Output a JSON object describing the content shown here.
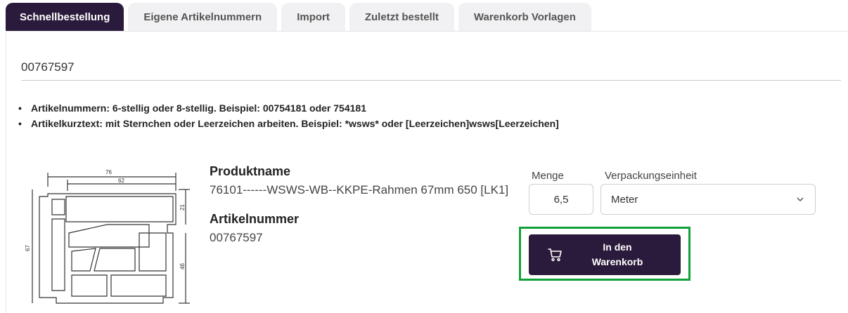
{
  "tabs": [
    {
      "label": "Schnellbestellung",
      "active": true
    },
    {
      "label": "Eigene Artikelnummern",
      "active": false
    },
    {
      "label": "Import",
      "active": false
    },
    {
      "label": "Zuletzt bestellt",
      "active": false
    },
    {
      "label": "Warenkorb Vorlagen",
      "active": false
    }
  ],
  "search": {
    "value": "00767597"
  },
  "hints": [
    "Artikelnummern: 6-stellig oder 8-stellig. Beispiel: 00754181 oder 754181",
    "Artikelkurztext: mit Sternchen oder Leerzeichen arbeiten. Beispiel: *wsws* oder [Leerzeichen]wsws[Leerzeichen]"
  ],
  "product": {
    "name_label": "Produktname",
    "name": "76101------WSWS-WB--KKPE-Rahmen 67mm 650 [LK1]",
    "number_label": "Artikelnummer",
    "number": "00767597",
    "drawing_dims": {
      "w1": "76",
      "w2": "62",
      "h1": "21",
      "h2": "67",
      "h3": "46"
    }
  },
  "order": {
    "menge_label": "Menge",
    "menge_value": "6,5",
    "vpe_label": "Verpackungseinheit",
    "vpe_value": "Meter",
    "cart_button_label": "In den\nWarenkorb"
  },
  "colors": {
    "accent": "#2a1a3b",
    "highlight": "#12a23a"
  }
}
